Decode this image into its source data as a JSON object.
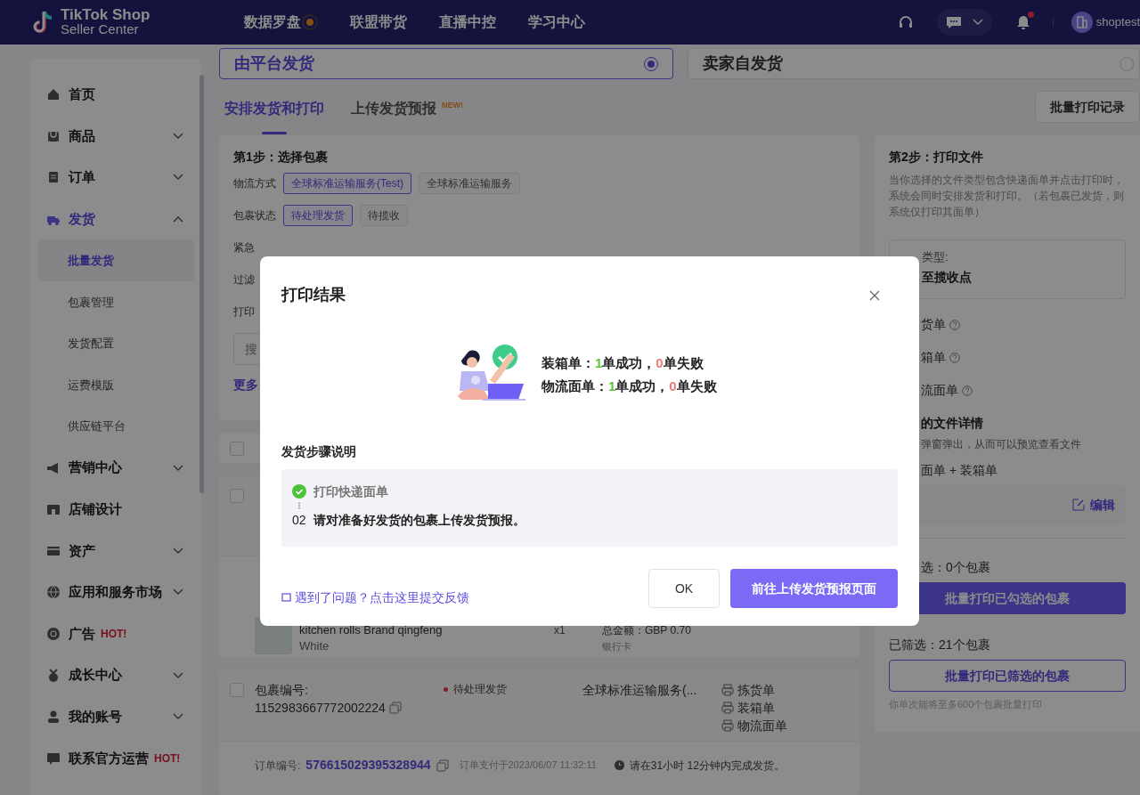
{
  "header": {
    "logo_line1": "TikTok Shop",
    "logo_line2": "Seller Center",
    "nav": [
      {
        "label": "数据罗盘",
        "dot": true
      },
      {
        "label": "联盟带货",
        "dot": false
      },
      {
        "label": "直播中控",
        "dot": false
      },
      {
        "label": "学习中心",
        "dot": false
      }
    ],
    "notification": true,
    "user": "shoptest"
  },
  "sidebar": {
    "items": [
      {
        "label": "首页",
        "selected": false
      },
      {
        "label": "商品",
        "expanded": false,
        "selected": false
      },
      {
        "label": "订单",
        "expanded": false,
        "selected": false
      },
      {
        "label": "发货",
        "expanded": true,
        "selected": true,
        "children": [
          {
            "label": "批量发货",
            "selected": true
          },
          {
            "label": "包裹管理",
            "selected": false
          },
          {
            "label": "发货配置",
            "selected": false
          },
          {
            "label": "运费模版",
            "selected": false
          },
          {
            "label": "供应链平台",
            "selected": false
          }
        ]
      },
      {
        "label": "营销中心",
        "expanded": false,
        "selected": false
      },
      {
        "label": "店铺设计",
        "selected": false
      },
      {
        "label": "资产",
        "expanded": false,
        "selected": false
      },
      {
        "label": "应用和服务市场",
        "expanded": false,
        "selected": false
      },
      {
        "label": "广告",
        "badge": "HOT!",
        "selected": false
      },
      {
        "label": "成长中心",
        "expanded": false,
        "selected": false
      },
      {
        "label": "我的账号",
        "expanded": false,
        "selected": false
      },
      {
        "label": "联系官方运营",
        "badge": "HOT!",
        "selected": false
      }
    ]
  },
  "shipping_options": [
    {
      "label": "由平台发货",
      "selected": true
    },
    {
      "label": "卖家自发货",
      "selected": false
    }
  ],
  "tabs": [
    {
      "label": "安排发货和打印",
      "selected": true
    },
    {
      "label": "上传发货预报",
      "badge": "NEW!",
      "selected": false
    }
  ],
  "print_history_button": "批量打印记录",
  "step1": {
    "title": "第1步：选择包裹",
    "filters": [
      {
        "label": "物流方式",
        "options": [
          {
            "label": "全球标准运输服务(Test)",
            "selected": true
          },
          {
            "label": "全球标准运输服务",
            "selected": false
          }
        ]
      },
      {
        "label": "包裹状态",
        "options": [
          {
            "label": "待处理发货",
            "selected": true
          },
          {
            "label": "待揽收",
            "selected": false
          }
        ]
      },
      {
        "label": "紧急"
      },
      {
        "label": "过滤"
      },
      {
        "label": "打印"
      }
    ],
    "search_placeholder": "搜",
    "more_link": "更多"
  },
  "list_header": {
    "checked": false
  },
  "partial_package": {
    "checked": false,
    "product": {
      "name": "kitchen rolls Brand qingfeng",
      "variant": "White",
      "quantity": "x1"
    },
    "total": "总金额：GBP 0.70",
    "payment": "银行卡"
  },
  "package": {
    "checked": false,
    "id_label": "包裹编号:",
    "id_value": "1152983667772002224",
    "status": "待处理发货",
    "carrier": "全球标准运输服务(...",
    "documents": [
      "拣货单",
      "装箱单",
      "物流面单"
    ],
    "order_label": "订单编号:",
    "order_id": "576615029395328944",
    "paid": "订单支付于2023/06/07 11:32:11",
    "deadline": "请在31小时 12分钟内完成发货。"
  },
  "step2": {
    "title": "第2步：打印文件",
    "description": "当你选择的文件类型包含快递面单并点击打印时，系统会同时安排发货和打印。（若包裹已发货，则系统仅打印其面单）",
    "type_label": "类型:",
    "type_value": "至揽收点",
    "documents": [
      "货单",
      "箱单",
      "流面单"
    ],
    "details_title": "的文件详情",
    "details_hint": "弹窗弹出，从而可以预览查看文件",
    "details_value": "面单 + 装箱单",
    "edit": "编辑",
    "selected_count": "选：0个包裹",
    "print_selected": "批量打印已勾选的包裹",
    "filtered_count": "已筛选：21个包裹",
    "print_filtered": "批量打印已筛选的包裹",
    "note": "你单次能将至多600个包裹批量打印"
  },
  "modal": {
    "title": "打印结果",
    "results": [
      {
        "label": "装箱单：",
        "success": "1",
        "success_text": "单成功，",
        "fail": "0",
        "fail_text": "单失败"
      },
      {
        "label": "物流面单：",
        "success": "1",
        "success_text": "单成功，",
        "fail": "0",
        "fail_text": "单失败"
      }
    ],
    "steps_title": "发货步骤说明",
    "steps": [
      {
        "done": true,
        "text": "打印快递面单"
      },
      {
        "done": false,
        "number": "02",
        "text": "请对准备好发货的包裹上传发货预报。"
      }
    ],
    "feedback_link": "遇到了问题？点击这里提交反馈",
    "ok_button": "OK",
    "primary_button": "前往上传发货预报页面"
  }
}
